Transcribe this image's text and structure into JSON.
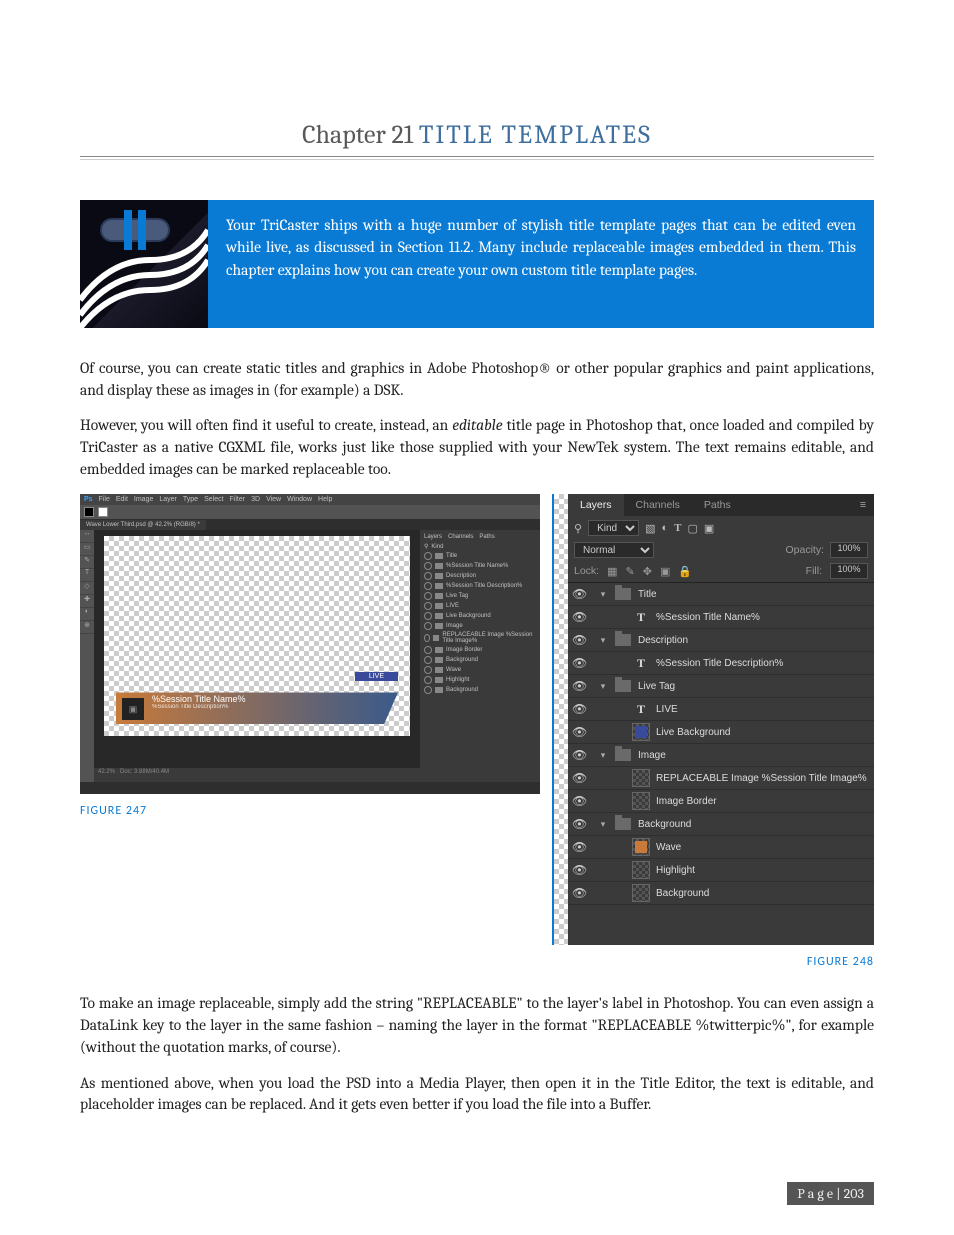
{
  "chapter": {
    "prefix": "Chapter 21",
    "title": "TITLE TEMPLATES"
  },
  "intro_box": "Your TriCaster ships with a huge number of stylish title template pages that can be edited even while live, as discussed in Section 11.2.  Many include replaceable images embedded in them.   This chapter explains how you can create your own custom title template pages.",
  "para1": "Of course, you can create static titles and graphics in Adobe Photoshop® or other popular graphics and paint applications, and display these as images in (for example) a DSK.",
  "para2_a": "However, you will often find it useful to create, instead, an ",
  "para2_em": "editable",
  "para2_b": " title page in Photoshop that, once loaded and compiled by TriCaster as a native CGXML file, works just like those supplied with your NewTek system. The text remains editable, and embedded images can be marked replaceable too.",
  "fig247": "FIGURE 247",
  "fig248": "FIGURE 248",
  "para3": "To make an image replaceable, simply add the string \"REPLACEABLE\" to the layer's label in Photoshop.  You can even assign a DataLink key to the layer in the same fashion – naming the layer in the format \"REPLACEABLE %twitterpic%\", for example (without the quotation marks, of course).",
  "para4": "As mentioned above, when you load the PSD into a Media Player, then open it in the Title Editor, the text is editable, and placeholder images can be replaced.  And it gets even better if you load the file into a Buffer.",
  "page_footer": "P a g e  | 203",
  "ps": {
    "menu": [
      "Ps",
      "File",
      "Edit",
      "Image",
      "Layer",
      "Type",
      "Select",
      "Filter",
      "3D",
      "View",
      "Window",
      "Help"
    ],
    "tab": "Wave Lower Third.psd @ 42.2% (RGB/8) *",
    "status_left": "42.2%",
    "status_doc": "Doc: 3.88M/40.4M",
    "lt_live": "LIVE",
    "lt_title": "%Session Title Name%",
    "lt_desc": "%Session Title Description%",
    "side": {
      "tabs": [
        "Layers",
        "Channels",
        "Paths"
      ],
      "kind": "Kind",
      "rows": [
        "Title",
        "%Session Title Name%",
        "Description",
        "%Session Title Description%",
        "Live Tag",
        "LIVE",
        "Live Background",
        "Image",
        "REPLACEABLE Image %Session Title Image%",
        "Image Border",
        "Background",
        "Wave",
        "Highlight",
        "Background"
      ]
    }
  },
  "layers_panel": {
    "tabs": [
      "Layers",
      "Channels",
      "Paths"
    ],
    "kind_label": "Kind",
    "blend_mode": "Normal",
    "opacity_label": "Opacity:",
    "opacity_value": "100%",
    "lock_label": "Lock:",
    "fill_label": "Fill:",
    "fill_value": "100%",
    "layers": [
      {
        "indent": 0,
        "twist": "▾",
        "type": "folder",
        "label": "Title"
      },
      {
        "indent": 1,
        "twist": "",
        "type": "text",
        "label": "%Session Title Name%"
      },
      {
        "indent": 0,
        "twist": "▾",
        "type": "folder",
        "label": "Description"
      },
      {
        "indent": 1,
        "twist": "",
        "type": "text",
        "label": "%Session Title Description%"
      },
      {
        "indent": 0,
        "twist": "▾",
        "type": "folder",
        "label": "Live Tag"
      },
      {
        "indent": 1,
        "twist": "",
        "type": "text",
        "label": "LIVE"
      },
      {
        "indent": 1,
        "twist": "",
        "type": "thumb",
        "label": "Live Background",
        "fill": "#3a4a9a"
      },
      {
        "indent": 0,
        "twist": "▾",
        "type": "folder",
        "label": "Image"
      },
      {
        "indent": 1,
        "twist": "",
        "type": "thumb",
        "label": "REPLACEABLE Image %Session Title Image%",
        "fill": ""
      },
      {
        "indent": 1,
        "twist": "",
        "type": "thumb",
        "label": "Image Border",
        "fill": ""
      },
      {
        "indent": 0,
        "twist": "▾",
        "type": "folder",
        "label": "Background"
      },
      {
        "indent": 1,
        "twist": "",
        "type": "thumb",
        "label": "Wave",
        "fill": "#c87a3a"
      },
      {
        "indent": 1,
        "twist": "",
        "type": "thumb",
        "label": "Highlight",
        "fill": ""
      },
      {
        "indent": 1,
        "twist": "",
        "type": "thumb",
        "label": "Background",
        "fill": ""
      }
    ]
  }
}
